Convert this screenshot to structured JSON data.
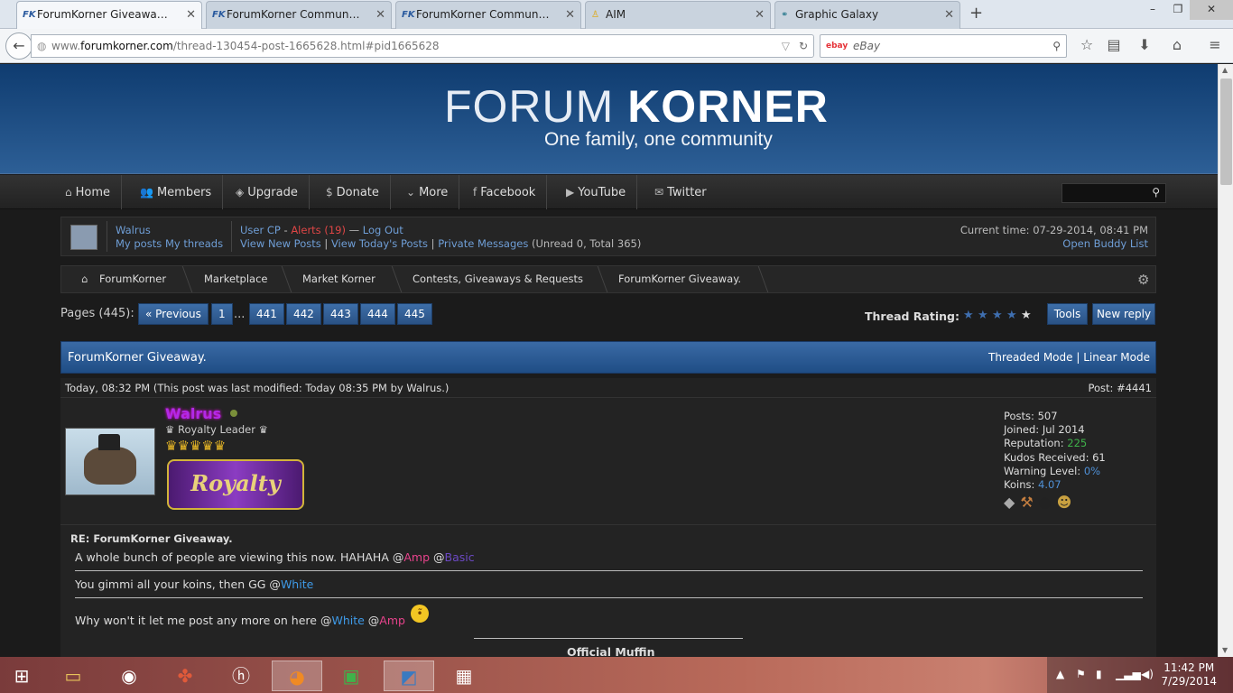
{
  "browser": {
    "tabs": [
      {
        "title": "ForumKorner Giveaway. (1)",
        "favicon": "FK",
        "active": true
      },
      {
        "title": "ForumKorner Community ...",
        "favicon": "FK",
        "active": false
      },
      {
        "title": "ForumKorner Community ...",
        "favicon": "FK",
        "active": false
      },
      {
        "title": "AIM",
        "favicon": "aim-icon",
        "active": false
      },
      {
        "title": "Graphic Galaxy",
        "favicon": "gg-icon",
        "active": false
      }
    ],
    "url_prefix": "www.",
    "url_domain": "forumkorner.com",
    "url_path": "/thread-130454-post-1665628.html#pid1665628",
    "search_engine": "ebay",
    "search_placeholder": "eBay"
  },
  "site": {
    "logo_left": "FORUM ",
    "logo_right": "KORNER",
    "tagline": "One family, one community",
    "menu": [
      "Home",
      "Members",
      "Upgrade",
      "Donate",
      "More",
      "Facebook",
      "YouTube",
      "Twitter"
    ]
  },
  "panel": {
    "username": "Walrus",
    "my_posts": "My posts",
    "my_threads": "My threads",
    "user_cp": "User CP",
    "dash": " - ",
    "alerts": "Alerts (19)",
    "mdash": " — ",
    "logout": "Log Out",
    "view_new": "View New Posts",
    "sep": " | ",
    "view_today": "View Today's Posts",
    "pms": "Private Messages",
    "pm_counts": "(Unread 0, Total 365)",
    "current_time": "Current time: 07-29-2014, 08:41 PM",
    "buddy_list": "Open Buddy List"
  },
  "breadcrumbs": [
    "ForumKorner",
    "Marketplace",
    "Market Korner",
    "Contests, Giveaways & Requests",
    "ForumKorner Giveaway."
  ],
  "pagination": {
    "label": "Pages (445):",
    "previous": "« Previous",
    "first": "1",
    "ellipsis": "...",
    "pages": [
      "441",
      "442",
      "443",
      "444",
      "445"
    ]
  },
  "rating_label": "Thread Rating:",
  "rating_value": 4,
  "tools": "Tools",
  "new_reply": "New reply",
  "thread_title": "ForumKorner Giveaway.",
  "threaded_mode": "Threaded Mode",
  "mode_sep": " | ",
  "linear_mode": "Linear Mode",
  "post": {
    "date": "Today, 08:32 PM (This post was last modified: Today 08:35 PM by Walrus.)",
    "number": "Post: #4441",
    "author": "Walrus",
    "rank": "♛ Royalty Leader ♛",
    "badge": "Royalty",
    "stats": {
      "posts_label": "Posts: ",
      "posts": "507",
      "joined_label": "Joined: ",
      "joined": "Jul 2014",
      "rep_label": "Reputation: ",
      "rep": "225",
      "kudos_label": "Kudos Received: ",
      "kudos": "61",
      "warn_label": "Warning Level: ",
      "warn": "0%",
      "koins_label": "Koins: ",
      "koins": "4.07"
    },
    "subject": "RE: ForumKorner Giveaway.",
    "line1_a": "A whole bunch of people are viewing this now. HAHAHA @",
    "line1_amp": "Amp",
    "line1_b": " @",
    "line1_basic": "Basic",
    "line2_a": "You gimmi all your koins, then GG @",
    "line2_white": "White",
    "line3_a": "Why won't it let me post any more on here @",
    "line3_white": "White",
    "line3_b": " @",
    "line3_amp": "Amp",
    "signature": "Official Muffin"
  },
  "taskbar": {
    "time": "11:42 PM",
    "date": "7/29/2014"
  }
}
